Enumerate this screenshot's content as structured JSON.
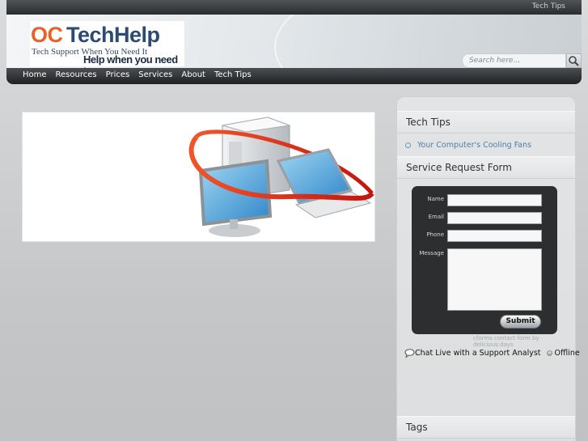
{
  "topbar": {
    "link": "Tech Tips"
  },
  "logo": {
    "oc": "OC",
    "tech_help": "TechHelp",
    "tagline1": "Tech Support When You Need It",
    "tagline2": "Help when you need it"
  },
  "search": {
    "placeholder": "Search here..."
  },
  "nav": {
    "items": [
      "Home",
      "Resources",
      "Prices",
      "Services",
      "About",
      "Tech Tips"
    ]
  },
  "sidebar": {
    "tech_tips_title": "Tech Tips",
    "tech_tips_item": "Your Computer's Cooling Fans",
    "service_title": "Service Request Form",
    "form": {
      "name_label": "Name",
      "email_label": "Email",
      "phone_label": "Phone",
      "message_label": "Message",
      "submit_label": "Submit"
    },
    "credit": "cforms contact form by delicious:days",
    "chat_label": "Chat Live with a Support Analyst",
    "chat_status": "Offline",
    "tags_title": "Tags"
  },
  "colors": {
    "accent_orange": "#e8622a",
    "brand_navy": "#2d4a73",
    "link_blue": "#4f7fa6",
    "nav_dark": "#2a2c2e"
  },
  "icons": [
    "search-icon",
    "chat-bubble-icon",
    "status-dot-icon",
    "computer-network-illustration"
  ]
}
